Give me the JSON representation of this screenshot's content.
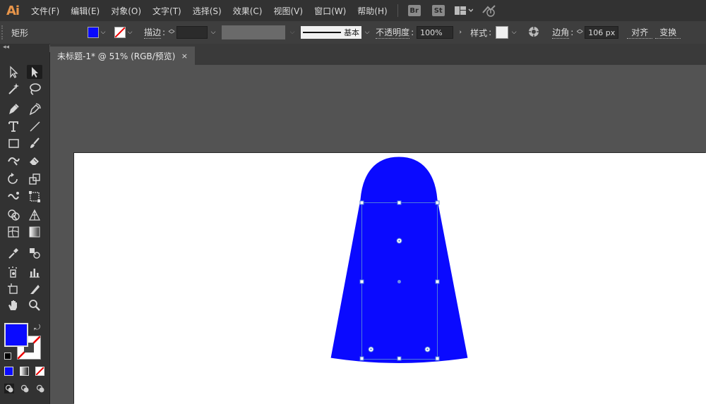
{
  "app": {
    "logo": "Ai"
  },
  "menu": {
    "items": [
      "文件(F)",
      "编辑(E)",
      "对象(O)",
      "文字(T)",
      "选择(S)",
      "效果(C)",
      "视图(V)",
      "窗口(W)",
      "帮助(H)"
    ],
    "bridge_label": "Br",
    "stock_label": "St"
  },
  "control": {
    "object_type": "矩形",
    "fill_color": "#0a0aff",
    "stroke_label": "描边",
    "brush_label": "基本",
    "opacity_label": "不透明度",
    "opacity_value": "100%",
    "style_label": "样式",
    "corner_label": "边角",
    "corner_value": "106 px",
    "align_label": "对齐",
    "transform_label": "变换"
  },
  "document": {
    "tab_title": "未标题-1* @ 51% (RGB/预览)",
    "close_glyph": "×"
  },
  "swatches": {
    "fill": "#0a0aff",
    "stroke": "none",
    "accent": "#0a0aff"
  },
  "icons": [
    "selection-tool-icon",
    "direct-selection-tool-icon",
    "magic-wand-icon",
    "lasso-icon",
    "pen-tool-icon",
    "curvature-tool-icon",
    "type-tool-icon",
    "line-tool-icon",
    "rectangle-tool-icon",
    "paintbrush-icon",
    "shaper-tool-icon",
    "eraser-icon",
    "rotate-tool-icon",
    "scale-tool-icon",
    "warp-tool-icon",
    "free-transform-icon",
    "shape-builder-icon",
    "perspective-grid-icon",
    "mesh-tool-icon",
    "gradient-tool-icon",
    "eyedropper-icon",
    "blend-tool-icon",
    "symbol-sprayer-icon",
    "graph-tool-icon",
    "artboard-tool-icon",
    "slice-tool-icon",
    "hand-tool-icon",
    "zoom-tool-icon"
  ]
}
